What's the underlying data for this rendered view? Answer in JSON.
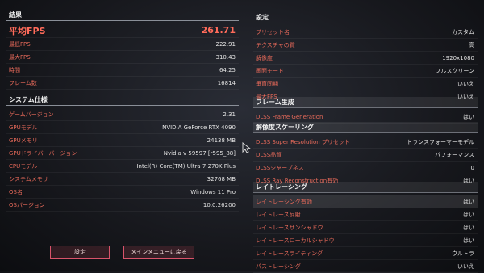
{
  "results": {
    "title": "結果",
    "avg_fps": {
      "label": "平均FPS",
      "value": "261.71"
    },
    "rows": [
      {
        "label": "最低FPS",
        "value": "222.91"
      },
      {
        "label": "最大FPS",
        "value": "310.43"
      },
      {
        "label": "時間",
        "value": "64.25"
      },
      {
        "label": "フレーム数",
        "value": "16814"
      }
    ]
  },
  "system": {
    "title": "システム仕様",
    "rows": [
      {
        "label": "ゲームバージョン",
        "value": "2.31"
      },
      {
        "label": "GPUモデル",
        "value": "NVIDIA GeForce RTX 4090"
      },
      {
        "label": "GPUメモリ",
        "value": "24138 MB"
      },
      {
        "label": "GPUドライバーバージョン",
        "value": "Nvidia v 59597 [r595_88]"
      },
      {
        "label": "CPUモデル",
        "value": "Intel(R) Core(TM) Ultra 7 270K Plus"
      },
      {
        "label": "システムメモリ",
        "value": "32768 MB"
      },
      {
        "label": "OS名",
        "value": "Windows 11 Pro"
      },
      {
        "label": "OSバージョン",
        "value": "10.0.26200"
      }
    ]
  },
  "settings": {
    "title": "設定",
    "rows": [
      {
        "label": "プリセット名",
        "value": "カスタム"
      },
      {
        "label": "テクスチャの質",
        "value": "高"
      },
      {
        "label": "解像度",
        "value": "1920x1080"
      },
      {
        "label": "画面モード",
        "value": "フルスクリーン"
      },
      {
        "label": "垂直同期",
        "value": "いいえ"
      },
      {
        "label": "最大FPS",
        "value": "いいえ"
      }
    ]
  },
  "framegen": {
    "title": "フレーム生成",
    "rows": [
      {
        "label": "DLSS Frame Generation",
        "value": "はい"
      }
    ]
  },
  "scaling": {
    "title": "解像度スケーリング",
    "rows": [
      {
        "label": "DLSS Super Resolution プリセット",
        "value": "トランスフォーマーモデル"
      },
      {
        "label": "DLSS品質",
        "value": "パフォーマンス"
      },
      {
        "label": "DLSSシャープネス",
        "value": "0"
      },
      {
        "label": "DLSS Ray Reconstruction有効",
        "value": "はい"
      }
    ]
  },
  "raytracing": {
    "title": "レイトレーシング",
    "rows": [
      {
        "label": "レイトレーシング有効",
        "value": "はい"
      },
      {
        "label": "レイトレース反射",
        "value": "はい"
      },
      {
        "label": "レイトレースサンシャドウ",
        "value": "はい"
      },
      {
        "label": "レイトレースローカルシャドウ",
        "value": "はい"
      },
      {
        "label": "レイトレースライティング",
        "value": "ウルトラ"
      },
      {
        "label": "パストレーシング",
        "value": "いいえ"
      }
    ]
  },
  "buttons": {
    "settings": "設定",
    "main_menu": "メインメニューに戻る"
  }
}
